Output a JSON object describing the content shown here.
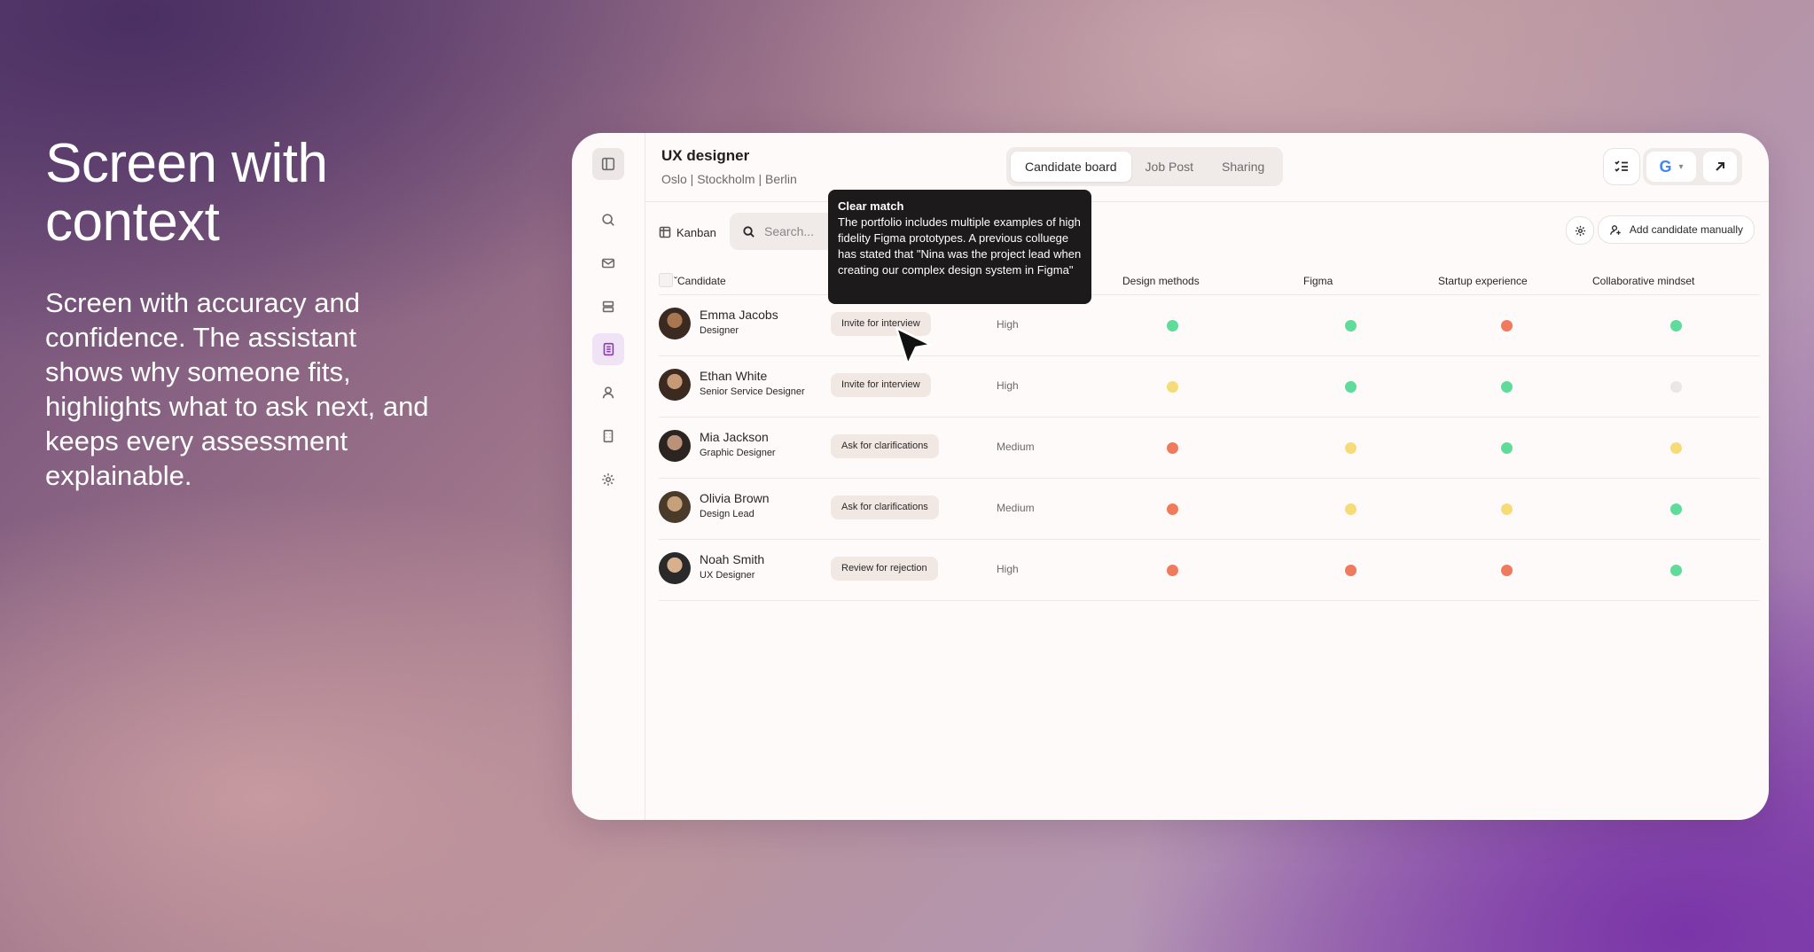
{
  "hero": {
    "title_line1": "Screen with",
    "title_line2": "context",
    "body": "Screen with accuracy and confidence. The assistant shows why someone fits, highlights what to ask next, and keeps every assessment explainable."
  },
  "job": {
    "title": "UX designer",
    "locations": "Oslo | Stockholm | Berlin"
  },
  "tabs": [
    {
      "label": "Candidate board",
      "active": true
    },
    {
      "label": "Job Post",
      "active": false
    },
    {
      "label": "Sharing",
      "active": false
    }
  ],
  "toolbar": {
    "kanban_label": "Kanban",
    "search_placeholder": "Search...",
    "add_candidate_label": "Add candidate manually",
    "google_letter": "G"
  },
  "table": {
    "columns": [
      "Candidate",
      "Design methods",
      "Figma",
      "Startup experience",
      "Collaborative mindset"
    ],
    "rows": [
      {
        "name": "Emma Jacobs",
        "role": "Designer",
        "action": "Invite for interview",
        "confidence": "High",
        "scores": [
          "green",
          "green",
          "red",
          "green"
        ]
      },
      {
        "name": "Ethan White",
        "role": "Senior Service Designer",
        "action": "Invite for interview",
        "confidence": "High",
        "scores": [
          "yellow",
          "green",
          "green",
          "grey"
        ]
      },
      {
        "name": "Mia Jackson",
        "role": "Graphic Designer",
        "action": "Ask for clarifications",
        "confidence": "Medium",
        "scores": [
          "red",
          "yellow",
          "green",
          "yellow"
        ]
      },
      {
        "name": "Olivia Brown",
        "role": "Design Lead",
        "action": "Ask for clarifications",
        "confidence": "Medium",
        "scores": [
          "red",
          "yellow",
          "yellow",
          "green"
        ]
      },
      {
        "name": "Noah Smith",
        "role": "UX Designer",
        "action": "Review for rejection",
        "confidence": "High",
        "scores": [
          "red",
          "red",
          "red",
          "green"
        ]
      }
    ]
  },
  "tooltip": {
    "title": "Clear match",
    "body": "The portfolio includes multiple examples of high fidelity Figma prototypes. A previous colluege has stated that \"Nina was the project lead when creating our complex design system in Figma\""
  },
  "colors": {
    "green": "#5fdb9a",
    "yellow": "#f6dc78",
    "red": "#f07a5c",
    "grey": "#ebe6e6",
    "accent": "#8a3bb5"
  }
}
